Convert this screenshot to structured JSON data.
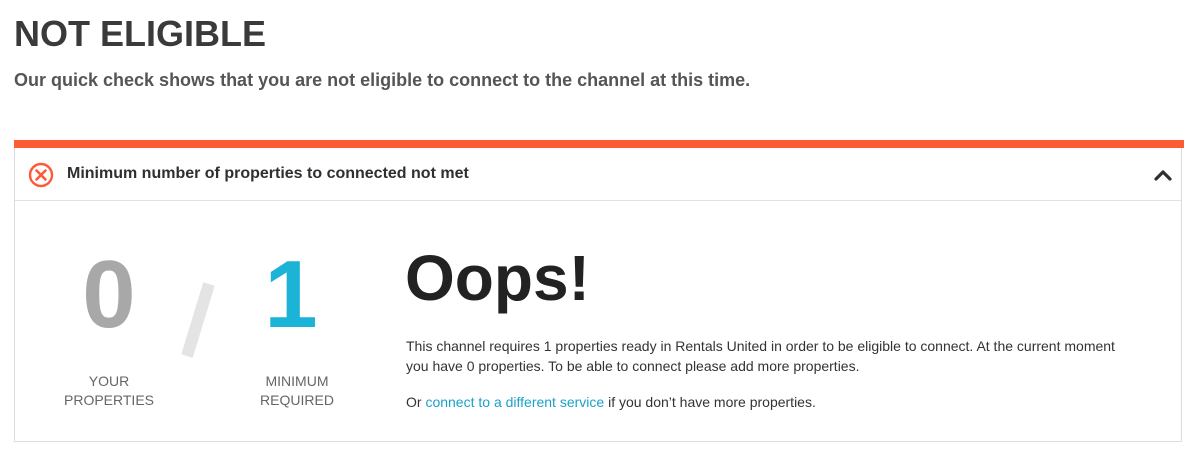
{
  "page": {
    "title": "NOT ELIGIBLE",
    "subtitle": "Our quick check shows that you are not eligible to connect to the channel at this time."
  },
  "panel": {
    "accent_color": "#ff5a36",
    "header_text": "Minimum number of properties to connected not met",
    "status_icon": "error-circle-x-icon",
    "toggle_icon": "chevron-up-icon",
    "your_count": "0",
    "your_label_line1": "YOUR",
    "your_label_line2": "PROPERTIES",
    "min_count": "1",
    "min_label_line1": "MINIMUM",
    "min_label_line2": "REQUIRED",
    "min_count_color": "#1bb3d6",
    "heading": "Oops!",
    "description": "This channel requires 1 properties ready in Rentals United in order to be eligible to connect. At the current moment you have 0 properties. To be able to connect please add more properties.",
    "alt_prefix": "Or ",
    "alt_link": "connect to a different service",
    "alt_suffix": " if you don’t have more properties."
  }
}
